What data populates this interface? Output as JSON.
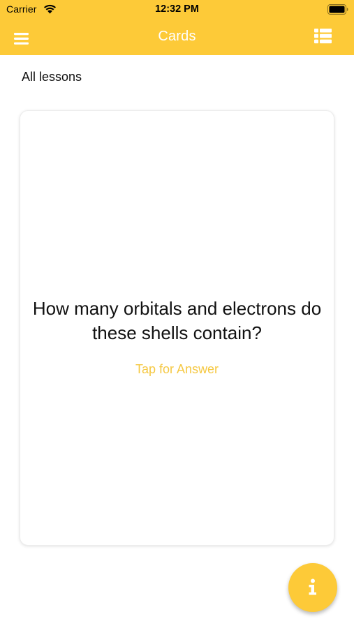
{
  "status_bar": {
    "carrier": "Carrier",
    "time": "12:32 PM",
    "wifi_icon": "wifi-icon",
    "battery_icon": "battery-icon"
  },
  "nav": {
    "title": "Cards",
    "menu_icon": "hamburger-menu-icon",
    "list_icon": "list-view-icon"
  },
  "lesson_filter": "All lessons",
  "card": {
    "question": "How many orbitals and electrons do these shells contain?",
    "hint": "Tap for Answer"
  },
  "fab": {
    "icon": "info-icon"
  },
  "colors": {
    "accent": "#fdca38",
    "hint_text": "#f5c842",
    "background": "#ffffff"
  }
}
